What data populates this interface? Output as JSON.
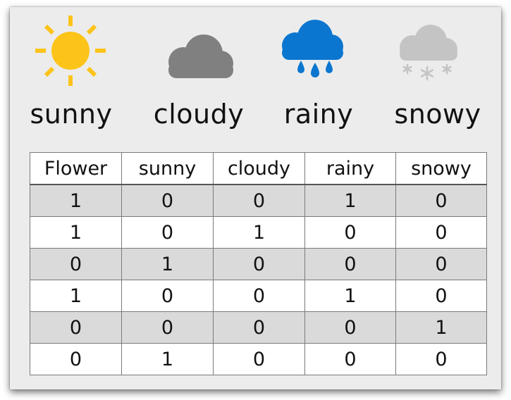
{
  "weather_types": [
    {
      "label": "sunny",
      "icon": "sun-icon",
      "color": "#fcc419"
    },
    {
      "label": "cloudy",
      "icon": "cloud-icon",
      "color": "#808080"
    },
    {
      "label": "rainy",
      "icon": "rain-cloud-icon",
      "color": "#0b76cf"
    },
    {
      "label": "snowy",
      "icon": "snow-cloud-icon",
      "color": "#c0c0c0"
    }
  ],
  "table": {
    "headers": [
      "Flower",
      "sunny",
      "cloudy",
      "rainy",
      "snowy"
    ],
    "rows": [
      [
        "1",
        "0",
        "0",
        "1",
        "0"
      ],
      [
        "1",
        "0",
        "1",
        "0",
        "0"
      ],
      [
        "0",
        "1",
        "0",
        "0",
        "0"
      ],
      [
        "1",
        "0",
        "0",
        "1",
        "0"
      ],
      [
        "0",
        "0",
        "0",
        "0",
        "1"
      ],
      [
        "0",
        "1",
        "0",
        "0",
        "0"
      ]
    ]
  }
}
